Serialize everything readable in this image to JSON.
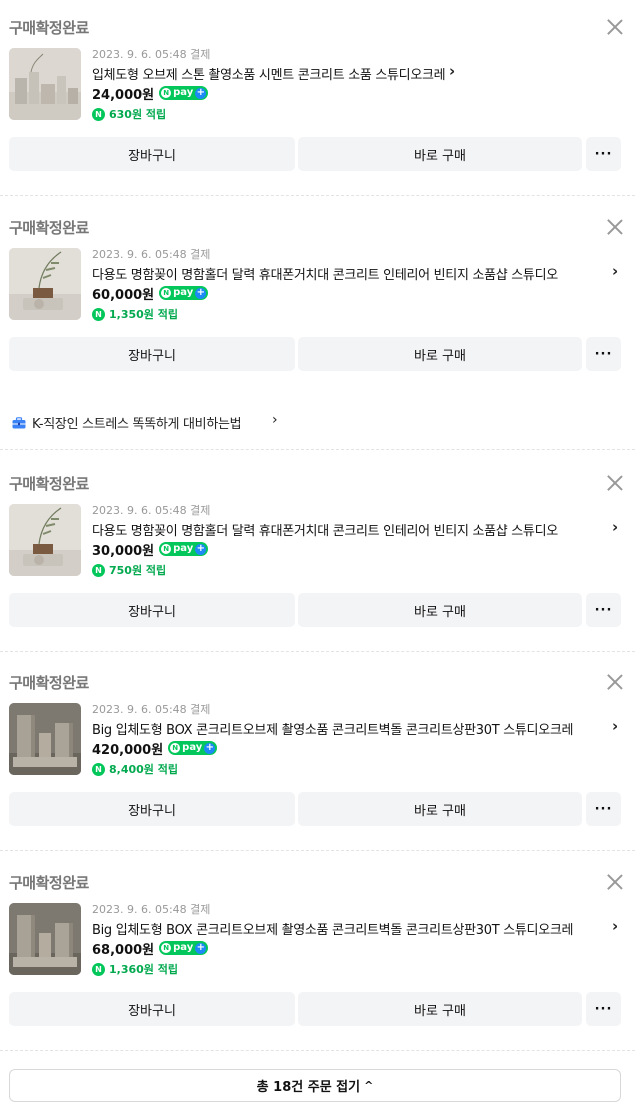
{
  "orders": [
    {
      "status": "구매확정완료",
      "date": "2023. 9. 6. 05:48 결제",
      "name": "입체도형 오브제 스톤 촬영소품 시멘트 콘크리트 소품 스튜디오크레",
      "price": "24,000원",
      "points": "630원 적립",
      "thumb": "cylinders-light"
    },
    {
      "status": "구매확정완료",
      "date": "2023. 9. 6. 05:48 결제",
      "name": "다용도 명함꽂이 명함홀더 달력 휴대폰거치대 콘크리트 인테리어 빈티지 소품샵 스튜디오",
      "price": "60,000원",
      "points": "1,350원 적립",
      "thumb": "card-holder"
    },
    {
      "status": "구매확정완료",
      "date": "2023. 9. 6. 05:48 결제",
      "name": "다용도 명함꽂이 명함홀더 달력 휴대폰거치대 콘크리트 인테리어 빈티지 소품샵 스튜디오",
      "price": "30,000원",
      "points": "750원 적립",
      "thumb": "card-holder"
    },
    {
      "status": "구매확정완료",
      "date": "2023. 9. 6. 05:48 결제",
      "name": "Big 입체도형 BOX 콘크리트오브제 촬영소품 콘크리트벽돌 콘크리트상판30T 스튜디오크레",
      "price": "420,000원",
      "points": "8,400원 적립",
      "thumb": "concrete-boxes"
    },
    {
      "status": "구매확정완료",
      "date": "2023. 9. 6. 05:48 결제",
      "name": "Big 입체도형 BOX 콘크리트오브제 촬영소품 콘크리트벽돌 콘크리트상판30T 스튜디오크레",
      "price": "68,000원",
      "points": "1,360원 적립",
      "thumb": "concrete-boxes"
    }
  ],
  "buttons": {
    "cart": "장바구니",
    "buy": "바로 구매",
    "more": "···"
  },
  "npay": {
    "n": "N",
    "pay": "pay",
    "plus": "+"
  },
  "point_icon": "N",
  "banner": {
    "text": "K-직장인 스트레스 똑똑하게 대비하는법",
    "icon": "briefcase-icon"
  },
  "fold": {
    "label": "총 18건 주문 접기",
    "chev": "^"
  },
  "colors": {
    "npay_green": "#03c75a",
    "npay_plus_blue": "#1e88f6",
    "status_gray": "#777777",
    "button_bg": "#f3f4f6",
    "banner_icon_blue": "#3b82f6"
  }
}
